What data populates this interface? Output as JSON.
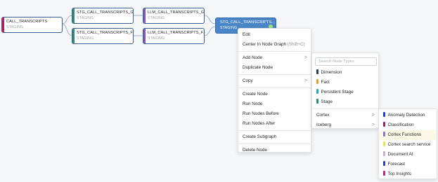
{
  "graph": {
    "nodes": [
      {
        "name": "CALL_TRANSCRIPTS",
        "type": "STAGING",
        "color": "#c2185b"
      },
      {
        "name": "STG_CALL_TRANSCRIPTS_G...",
        "type": "STAGING",
        "color": "#2e8b7a"
      },
      {
        "name": "LLM_CALL_TRANSCRIPTS_G...",
        "type": "STAGING",
        "color": "#7e57c2"
      },
      {
        "name": "STG_CALL_TRANSCRIPTS_F...",
        "type": "STAGING",
        "color": "#2e8b7a"
      },
      {
        "name": "LLM_CALL_TRANSCRIPTS_F...",
        "type": "STAGING",
        "color": "#7e57c2"
      },
      {
        "name": "STG_CALL_TRANSCRIPTS...",
        "type": "STAGING",
        "selected": true,
        "status_color": "#9fe07f"
      }
    ]
  },
  "context_menu": {
    "edit": "Edit",
    "center": "Center In Node Graph",
    "center_shortcut": "(Shift+C)",
    "add_node": "Add Node",
    "duplicate_node": "Duplicate Node",
    "copy": "Copy",
    "create_node": "Create Node",
    "run_node": "Run Node",
    "run_nodes_before": "Run Nodes Before",
    "run_nodes_after": "Run Nodes After",
    "create_subgraph": "Create Subgraph",
    "delete_node": "Delete Node",
    "chevron": ">"
  },
  "add_node_menu": {
    "search_placeholder": "Search Node Types",
    "types": [
      {
        "label": "Dimension",
        "color": "#2b3a67"
      },
      {
        "label": "Fact",
        "color": "#e0a030"
      },
      {
        "label": "Persistent Stage",
        "color": "#2aa6b5"
      },
      {
        "label": "Stage",
        "color": "#2e8b7a"
      }
    ],
    "cortex": "Cortex",
    "iceberg": "Iceberg"
  },
  "cortex_menu": {
    "items": [
      {
        "label": "Anomaly Detection",
        "color": "#1f3fd6"
      },
      {
        "label": "Classification",
        "color": "#9c1f6a"
      },
      {
        "label": "Cortex Functions",
        "color": "#8e6fd8",
        "highlighted": true
      },
      {
        "label": "Cortex search service",
        "color": "#f2e24a"
      },
      {
        "label": "Document AI",
        "color": "#c8a8ec"
      },
      {
        "label": "Forecast",
        "color": "#1f3fd6"
      },
      {
        "label": "Top Insights",
        "color": "#c0287a"
      }
    ]
  }
}
